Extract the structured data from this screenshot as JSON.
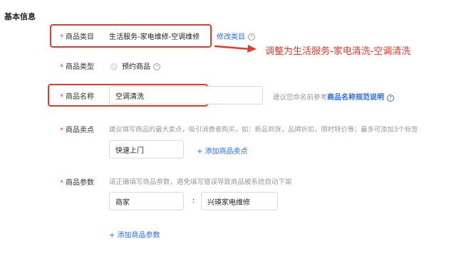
{
  "section": {
    "title": "基本信息"
  },
  "fields": {
    "category": {
      "required": "*",
      "label": "商品类目",
      "value": "生活服务-家电维修-空调维修",
      "edit_link": "修改类目",
      "help": "?"
    },
    "product_type": {
      "required": "*",
      "label": "商品类型",
      "option": "预约商品",
      "help": "?"
    },
    "product_name": {
      "required": "*",
      "label": "商品名称",
      "value": "空调清洗",
      "hint_prefix": "建议您命名前参考",
      "hint_link": "商品名称规范说明",
      "help": "?"
    },
    "selling_points": {
      "required": "*",
      "label": "商品卖点",
      "hint": "建议填写商品的最大卖点，吸引消费者购买，如：新品到货，品牌折扣，限时特价等；最多可添加3个标签",
      "tag_value": "快速上门",
      "add_link": "+ 添加商品卖点"
    },
    "params": {
      "required": "*",
      "label": "商品参数",
      "hint": "请正确填写商品参数，避免填写错误导致商品被系统自动下架",
      "key_value": "商家",
      "separator": ":",
      "param_value": "兴瑛家电维修",
      "add_link": "+ 添加商品参数"
    }
  },
  "annotation": {
    "text": "调整为生活服务-家电清洗-空调清洗",
    "color": "#e23b2e"
  }
}
